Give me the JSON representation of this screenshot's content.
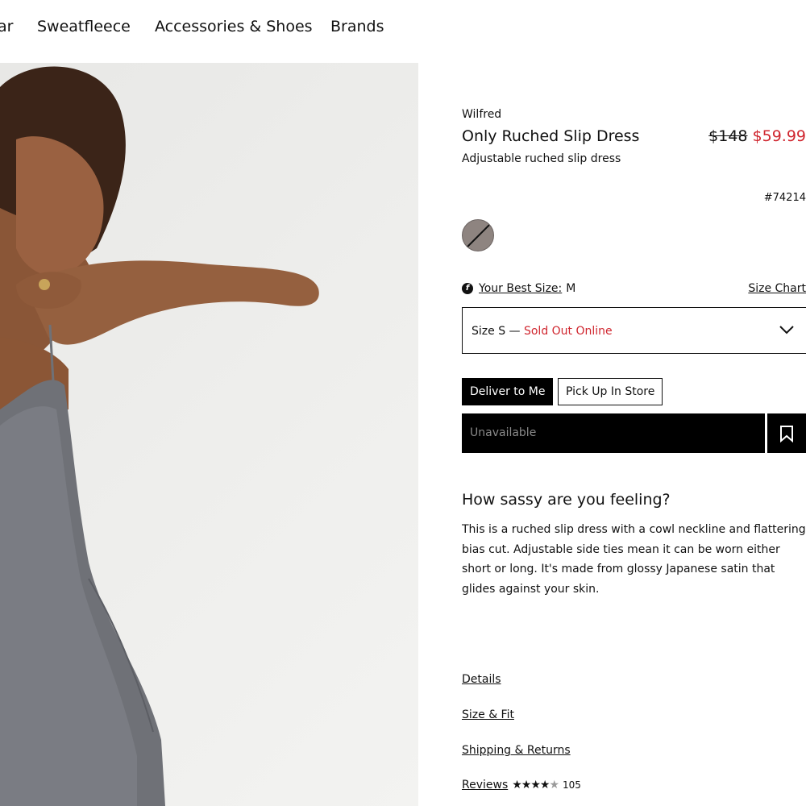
{
  "nav": {
    "items": [
      "ar",
      "Sweatfleece",
      "Accessories & Shoes",
      "Brands"
    ]
  },
  "product": {
    "brand": "Wilfred",
    "name": "Only Ruched Slip Dress",
    "subtitle": "Adjustable ruched slip dress",
    "price_old": "$148",
    "price_new": "$59.99",
    "sku": "#74214",
    "swatch_color": "#8e8480"
  },
  "size": {
    "best_size_label": "Your Best Size:",
    "best_size_value": "M",
    "size_chart_label": "Size Chart",
    "selected_label": "Size S —",
    "selected_status": "Sold Out Online",
    "chevron_icon": "chevron-down-icon"
  },
  "delivery": {
    "deliver_label": "Deliver to Me",
    "pickup_label": "Pick Up In Store"
  },
  "cart": {
    "unavailable_label": "Unavailable",
    "wishlist_icon": "bookmark-icon"
  },
  "description": {
    "heading": "How sassy are you feeling?",
    "body": "This is a ruched slip dress with a cowl neckline and flattering bias cut. Adjustable side ties mean it can be worn either short or long. It's made from glossy Japanese satin that glides against your skin."
  },
  "accordion": {
    "details": "Details",
    "size_fit": "Size & Fit",
    "shipping": "Shipping & Returns",
    "reviews": "Reviews",
    "review_count": "105",
    "rating_stars": 4
  },
  "colors": {
    "sale_red": "#d0262f",
    "primary_black": "#000000"
  }
}
